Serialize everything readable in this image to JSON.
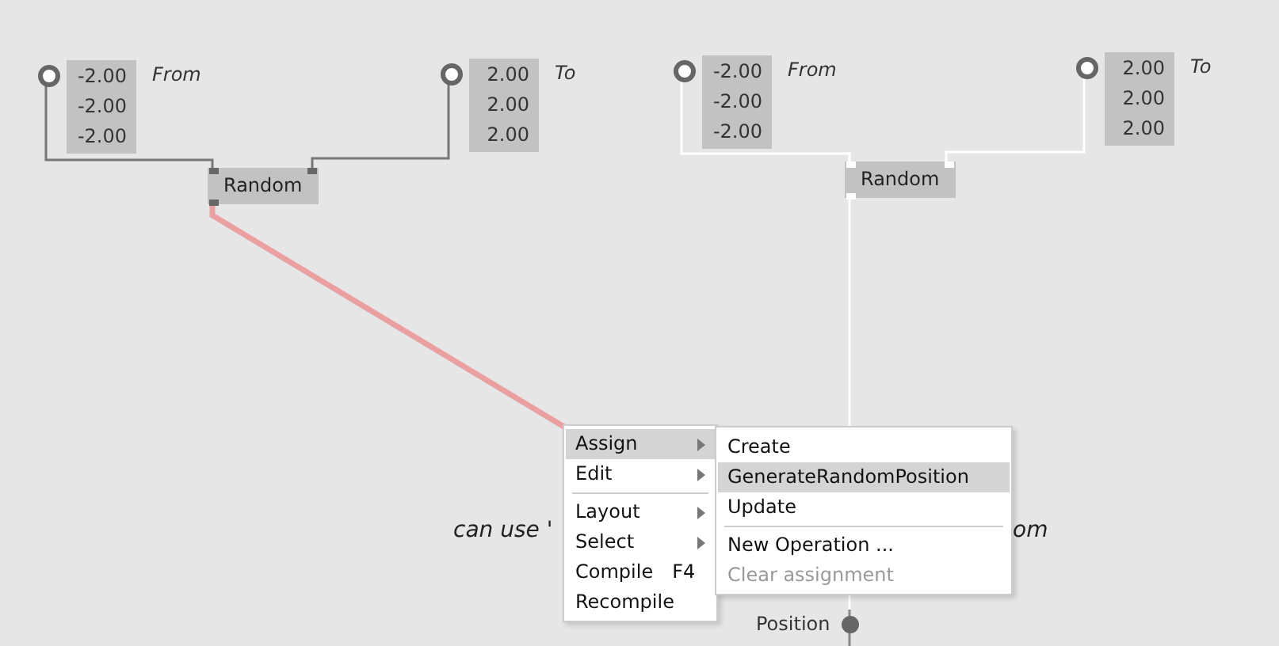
{
  "nodes": [
    {
      "kind": "vector",
      "values": [
        "-2.00",
        "-2.00",
        "-2.00"
      ],
      "label": "From"
    },
    {
      "kind": "vector",
      "values": [
        "2.00",
        "2.00",
        "2.00"
      ],
      "label": "To"
    },
    {
      "kind": "operation",
      "title": "Random"
    },
    {
      "kind": "vector",
      "values": [
        "-2.00",
        "-2.00",
        "-2.00"
      ],
      "label": "From"
    },
    {
      "kind": "vector",
      "values": [
        "2.00",
        "2.00",
        "2.00"
      ],
      "label": "To"
    },
    {
      "kind": "operation",
      "title": "Random"
    },
    {
      "kind": "output",
      "label": "Position"
    }
  ],
  "comment": [
    "can use '",
    "om"
  ],
  "context_menu": {
    "items": [
      {
        "kind": "item",
        "label": "Assign",
        "submenu": true,
        "selected": true
      },
      {
        "kind": "item",
        "label": "Edit",
        "submenu": true,
        "selected": false
      },
      {
        "kind": "separator"
      },
      {
        "kind": "item",
        "label": "Layout",
        "submenu": true,
        "selected": false
      },
      {
        "kind": "item",
        "label": "Select",
        "submenu": true,
        "selected": false
      },
      {
        "kind": "item",
        "label": "Compile",
        "shortcut": "F4",
        "submenu": false,
        "selected": false
      },
      {
        "kind": "item",
        "label": "Recompile",
        "submenu": false,
        "selected": false
      }
    ]
  },
  "submenu": {
    "items": [
      {
        "kind": "item",
        "label": "Create",
        "selected": false,
        "disabled": false
      },
      {
        "kind": "item",
        "label": "GenerateRandomPosition",
        "selected": true,
        "disabled": false
      },
      {
        "kind": "item",
        "label": "Update",
        "selected": false,
        "disabled": false
      },
      {
        "kind": "separator"
      },
      {
        "kind": "item",
        "label": "New Operation ...",
        "selected": false,
        "disabled": false
      },
      {
        "kind": "item",
        "label": "Clear assignment",
        "selected": false,
        "disabled": true
      }
    ]
  }
}
